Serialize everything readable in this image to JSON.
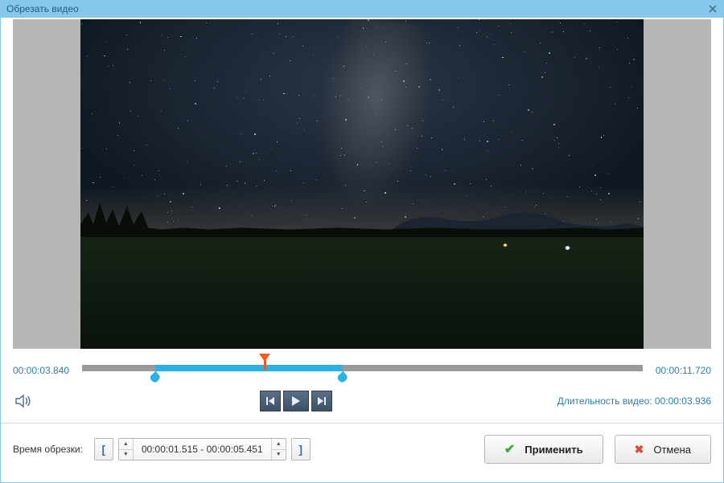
{
  "window": {
    "title": "Обрезать видео"
  },
  "timecodes": {
    "start": "00:00:03.840",
    "end": "00:00:11.720"
  },
  "timeline": {
    "selection_start_pct": 13,
    "selection_end_pct": 46.5,
    "marker_pct": 32.5
  },
  "duration": {
    "label": "Длительность видео: ",
    "value": "00:00:03.936"
  },
  "trim": {
    "label": "Время обрезки:",
    "range_text": "00:00:01.515 - 00:00:05.451"
  },
  "buttons": {
    "apply": "Применить",
    "cancel": "Отмена"
  }
}
